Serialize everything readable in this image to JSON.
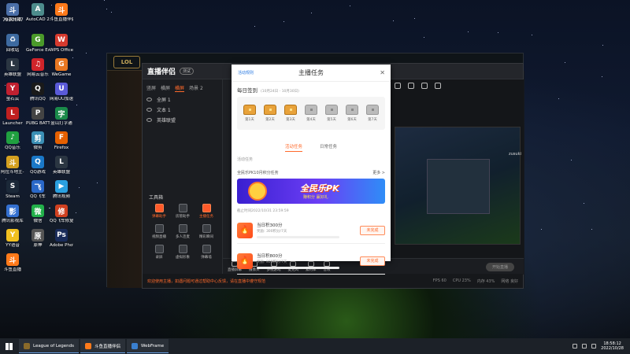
{
  "desktop": {
    "user_label": "7920647",
    "icons": [
      {
        "label": "点我开播",
        "color": "#4b6fa8",
        "glyph": "斗"
      },
      {
        "label": "AutoCAD 2007 - S...",
        "color": "#4d8c8c",
        "glyph": "A"
      },
      {
        "label": "斗鱼直播伴侣",
        "color": "#ff7a1a",
        "glyph": "斗"
      },
      {
        "label": "回收站",
        "color": "#3d6aa0",
        "glyph": "♻"
      },
      {
        "label": "GeForce Experience",
        "color": "#4a9a2a",
        "glyph": "G"
      },
      {
        "label": "WPS Office",
        "color": "#d63a2e",
        "glyph": "W"
      },
      {
        "label": "英雄联盟",
        "color": "#2b3642",
        "glyph": "L"
      },
      {
        "label": "网易云音乐",
        "color": "#d0242a",
        "glyph": "♫"
      },
      {
        "label": "WeGame",
        "color": "#e87722",
        "glyph": "G"
      },
      {
        "label": "萤石云",
        "color": "#c02030",
        "glyph": "Y"
      },
      {
        "label": "腾讯QQ",
        "color": "#1a1a1a",
        "glyph": "Q"
      },
      {
        "label": "网易UU加速器",
        "color": "#5a5ad8",
        "glyph": "U"
      },
      {
        "label": "Launcher",
        "color": "#c02020",
        "glyph": "L"
      },
      {
        "label": "PUBG BATTLEGR...",
        "color": "#444",
        "glyph": "P"
      },
      {
        "label": "金山打字通",
        "color": "#1a8a4a",
        "glyph": "字"
      },
      {
        "label": "QQ音乐",
        "color": "#20a040",
        "glyph": "♪"
      },
      {
        "label": "微剪",
        "color": "#3b8fb5",
        "glyph": "剪"
      },
      {
        "label": "Firefox",
        "color": "#e66000",
        "glyph": "F"
      },
      {
        "label": "阿拉斗地主-多人游戏版",
        "color": "#d4a020",
        "glyph": "斗"
      },
      {
        "label": "QQ游戏",
        "color": "#1a78c8",
        "glyph": "Q"
      },
      {
        "label": "英雄联盟",
        "color": "#2b3642",
        "glyph": "L"
      },
      {
        "label": "Steam",
        "color": "#1b2838",
        "glyph": "S"
      },
      {
        "label": "QQ飞车",
        "color": "#2a68c8",
        "glyph": "飞"
      },
      {
        "label": "腾讯视频",
        "color": "#2aa0e0",
        "glyph": "▶"
      },
      {
        "label": "腾讯影视库",
        "color": "#3470d0",
        "glyph": "影"
      },
      {
        "label": "微信",
        "color": "#22b04a",
        "glyph": "微"
      },
      {
        "label": "QQ飞车修复工具",
        "color": "#d04020",
        "glyph": "修"
      },
      {
        "label": "YY语音",
        "color": "#f0c020",
        "glyph": "Y"
      },
      {
        "label": "原神",
        "color": "#555",
        "glyph": "原"
      },
      {
        "label": "Adobe Photosh...",
        "color": "#1a2c5a",
        "glyph": "Ps"
      },
      {
        "label": "斗鱼直播",
        "color": "#ff7a1a",
        "glyph": "斗"
      }
    ]
  },
  "lol_window": {
    "badge": "LOL"
  },
  "companion": {
    "logo": "直播伴侣",
    "beta": "测试",
    "tabs": [
      "竖屏",
      "横屏",
      "横屏",
      "场景 2"
    ],
    "scenes": [
      "全屏 1",
      "文本 1",
      "英雄联盟"
    ],
    "tools_title": "工具箱",
    "tools": [
      {
        "label": "弹幕助手",
        "hot": true
      },
      {
        "label": "房管助手",
        "hot": false
      },
      {
        "label": "主播任务",
        "hot": true
      },
      {
        "label": "视频直播",
        "hot": false
      },
      {
        "label": "多人连麦",
        "hot": false
      },
      {
        "label": "精彩瞬间",
        "hot": false
      },
      {
        "label": "录屏",
        "hot": false
      },
      {
        "label": "虚拟形象",
        "hot": false
      },
      {
        "label": "弹幕墙",
        "hot": false
      }
    ],
    "bottom_items": [
      "直播屏幕",
      "摄像头",
      "多视游戏",
      "麦克风",
      "素材库",
      "音效"
    ],
    "go_live": "开始直播",
    "status_msg": "欢迎使用主播，如遇问题可通过帮助中心反馈，请在直播中遵守规范",
    "fps": [
      "FPS 60",
      "CPU 23%",
      "内存 43%",
      "网络 良好"
    ],
    "side_text": "zusuki"
  },
  "dialog": {
    "rule_link": "活动规则",
    "title": "主播任务",
    "close": "✕",
    "daily": {
      "title": "每日签到",
      "range": "(10月24日 - 10月30日)"
    },
    "days": [
      {
        "label": "第1天",
        "done": true
      },
      {
        "label": "第2天",
        "done": true
      },
      {
        "label": "第3天",
        "done": true
      },
      {
        "label": "第4天",
        "done": false
      },
      {
        "label": "第5天",
        "done": false
      },
      {
        "label": "第6天",
        "done": false
      },
      {
        "label": "第7天",
        "done": false
      }
    ],
    "tabs": [
      "活动任务",
      "日常任务"
    ],
    "active_tab": 0,
    "sub_tab": "活动任务",
    "pk": {
      "title": "全民乐PK10月积分任务",
      "more": "更多 >",
      "banner_big": "全民乐PK",
      "banner_small": "赚积分 赢好礼"
    },
    "deadline": "截止时间2022/10/31 23:59:59",
    "tasks": [
      {
        "name": "当日积300分",
        "progress": "奖励: 300积分/7天",
        "button": "未完成",
        "fraction": 0
      },
      {
        "name": "当日积800分",
        "progress": "奖励: 800积分/7天",
        "button": "未完成",
        "fraction": 0
      }
    ]
  },
  "taskbar": {
    "tasks": [
      {
        "label": "League of Legends",
        "color": "#8a6a2a"
      },
      {
        "label": "斗鱼直播伴侣",
        "color": "#ff7a1a"
      },
      {
        "label": "WebFrame",
        "color": "#3a80d0"
      }
    ],
    "time": "18:58:12",
    "date": "2022/10/28"
  }
}
